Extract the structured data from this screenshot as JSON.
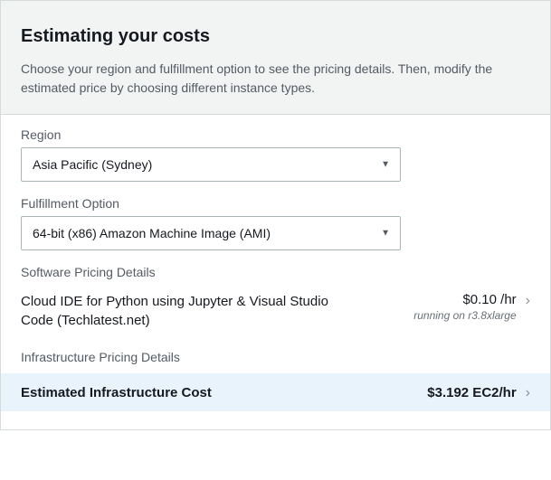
{
  "header": {
    "title": "Estimating your costs",
    "description": "Choose your region and fulfillment option to see the pricing details. Then, modify the estimated price by choosing different instance types."
  },
  "region": {
    "label": "Region",
    "value": "Asia Pacific (Sydney)"
  },
  "fulfillment": {
    "label": "Fulfillment Option",
    "value": "64-bit (x86) Amazon Machine Image (AMI)"
  },
  "software": {
    "section_label": "Software Pricing Details",
    "name": "Cloud IDE for Python using Jupyter & Visual Studio Code (Techlatest.net)",
    "price": "$0.10 /hr",
    "sub": "running on r3.8xlarge"
  },
  "infra": {
    "section_label": "Infrastructure Pricing Details",
    "label": "Estimated Infrastructure Cost",
    "price": "$3.192 EC2/hr"
  }
}
